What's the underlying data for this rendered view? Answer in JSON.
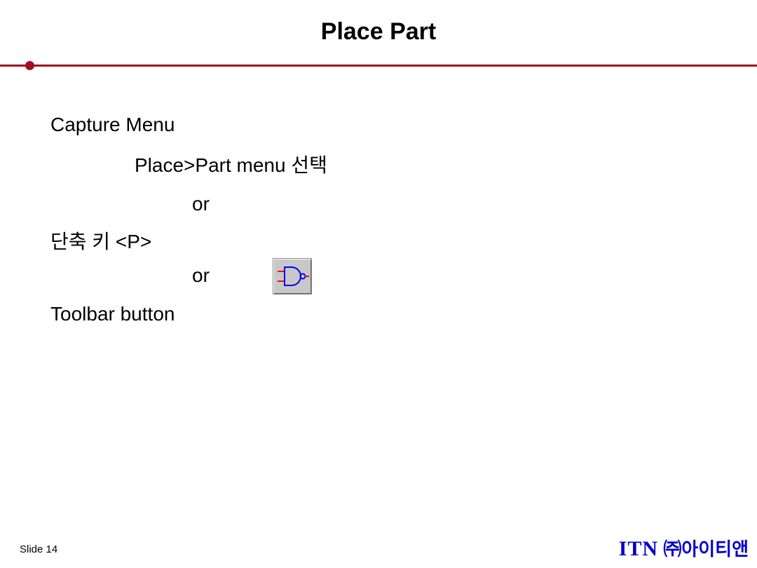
{
  "title": "Place Part",
  "content": {
    "capture_menu": "Capture Menu",
    "place_part_menu": "Place>Part menu 선택",
    "or1": "or",
    "shortcut": "단축 키 <P>",
    "or2": "or",
    "toolbar_button": "Toolbar button"
  },
  "icon": {
    "name": "nand-gate-icon",
    "stroke_color": "#0000ff",
    "pin_color": "#ff0000"
  },
  "footer": {
    "slide": "Slide 14",
    "brand_itn": "ITN",
    "brand_rest": " ㈜아이티앤"
  },
  "colors": {
    "accent": "#a01020",
    "brand": "#0000cc"
  }
}
